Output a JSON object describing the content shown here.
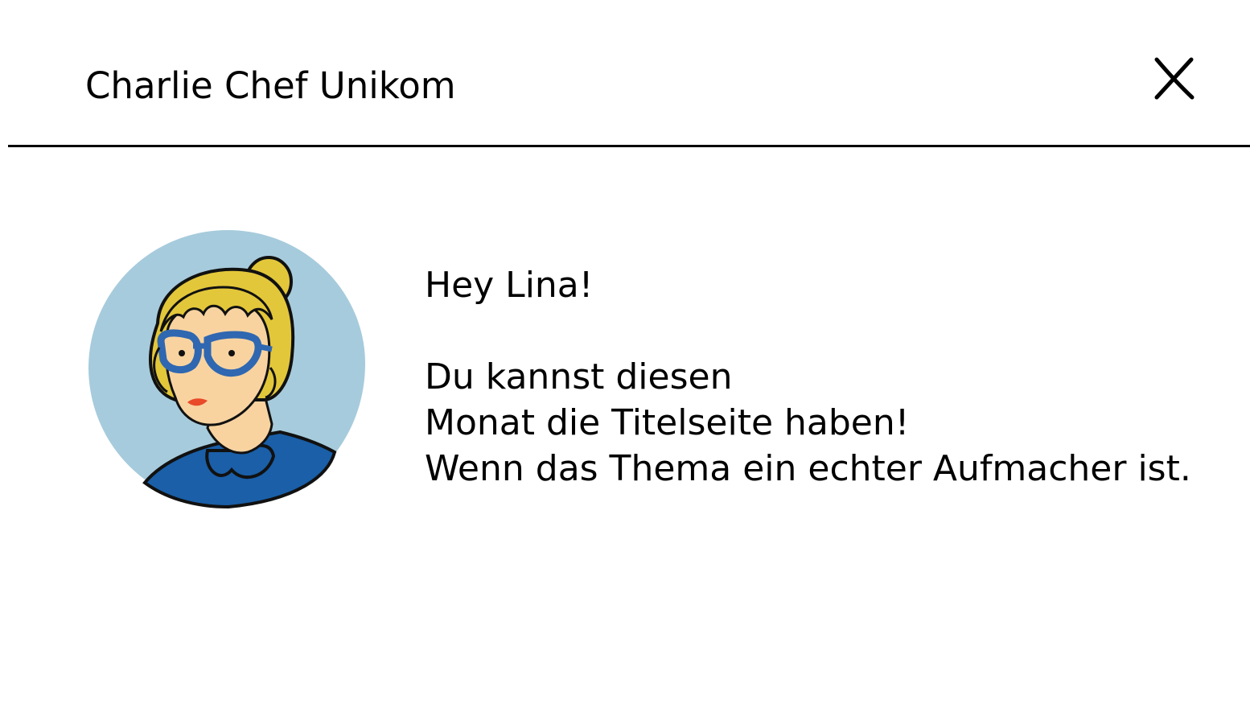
{
  "dialog": {
    "title": "Charlie Chef Unikom",
    "close_icon": "close-icon"
  },
  "avatar": {
    "icon": "woman-portrait-illustration",
    "colors": {
      "background": "#a6cbdc",
      "hair": "#e3c73a",
      "glasses": "#2f67b1",
      "shirt": "#1a5fa8",
      "skin": "#f8d3a0",
      "lips": "#e84a2a"
    }
  },
  "message": {
    "greeting": "Hey Lina!",
    "line1": "Du kannst diesen",
    "line2": "Monat die Titelseite haben!",
    "line3": "Wenn das Thema ein echter Aufmacher ist."
  }
}
